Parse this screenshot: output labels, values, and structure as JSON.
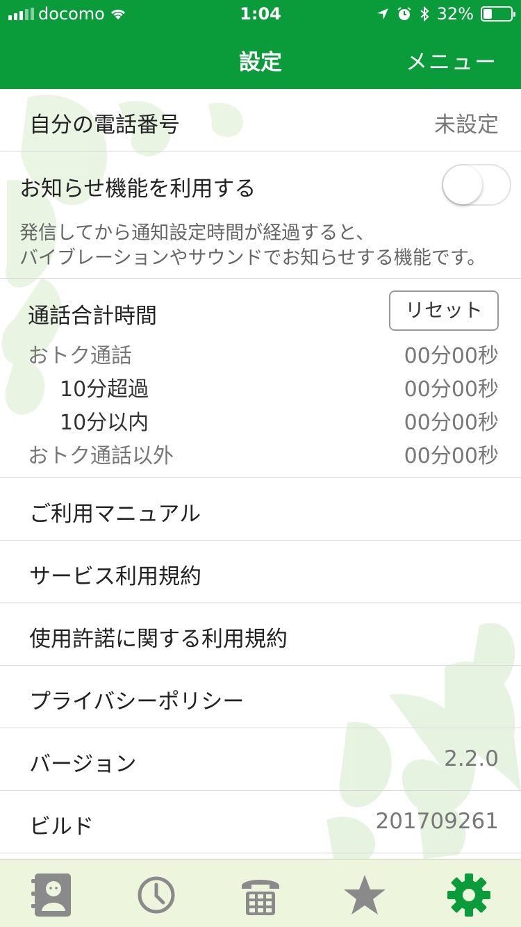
{
  "status_bar": {
    "carrier": "docomo",
    "time": "1:04",
    "battery_text": "32%",
    "battery_level": 0.32
  },
  "nav": {
    "title": "設定",
    "menu_label": "メニュー"
  },
  "phone_number": {
    "label": "自分の電話番号",
    "value": "未設定"
  },
  "notification": {
    "label": "お知らせ機能を利用する",
    "enabled": false,
    "description_line1": "発信してから通知設定時間が経過すると、",
    "description_line2": "バイブレーションやサウンドでお知らせする機能です。"
  },
  "call_total": {
    "label": "通話合計時間",
    "reset_label": "リセット",
    "items": [
      {
        "label": "おトク通話",
        "value": "00分00秒"
      },
      {
        "label": "10分超過",
        "value": "00分00秒"
      },
      {
        "label": "10分以内",
        "value": "00分00秒"
      },
      {
        "label": "おトク通話以外",
        "value": "00分00秒"
      }
    ]
  },
  "menu_items": [
    {
      "label": "ご利用マニュアル"
    },
    {
      "label": "サービス利用規約"
    },
    {
      "label": "使用許諾に関する利用規約"
    },
    {
      "label": "プライバシーポリシー"
    }
  ],
  "version": {
    "label": "バージョン",
    "value": "2.2.0"
  },
  "build": {
    "label": "ビルド",
    "value": "201709261"
  },
  "tabs": [
    {
      "icon": "contacts-icon"
    },
    {
      "icon": "history-clock-icon"
    },
    {
      "icon": "keypad-phone-icon"
    },
    {
      "icon": "favorites-star-icon"
    },
    {
      "icon": "settings-gear-icon",
      "active": true
    }
  ],
  "colors": {
    "brand_green": "#0a9c3b",
    "tab_bar_bg": "#eef5dd",
    "tab_icon_inactive": "#8a8a8a",
    "tab_icon_active": "#0a9c3b"
  }
}
